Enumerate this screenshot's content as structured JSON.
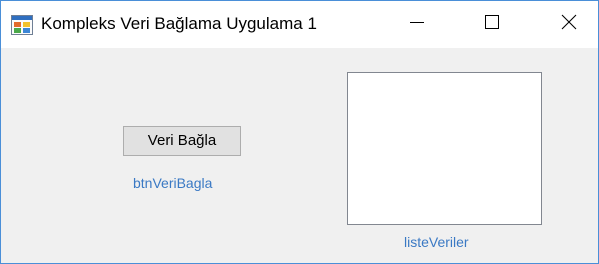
{
  "window": {
    "title": "Kompleks Veri Bağlama Uygulama 1",
    "icon": "winforms-app-icon",
    "controls": {
      "minimize_icon": "minimize-icon",
      "maximize_icon": "maximize-icon",
      "close_icon": "close-icon"
    }
  },
  "form": {
    "button": {
      "label": "Veri Bağla",
      "designer_name": "btnVeriBagla"
    },
    "listbox": {
      "items": [],
      "designer_name": "listeVeriler"
    }
  },
  "colors": {
    "client_background": "#f0f0f0",
    "title_background": "#ffffff",
    "window_border": "#4a8fd8",
    "designer_label": "#3a79c4",
    "button_background": "#e1e1e1"
  }
}
